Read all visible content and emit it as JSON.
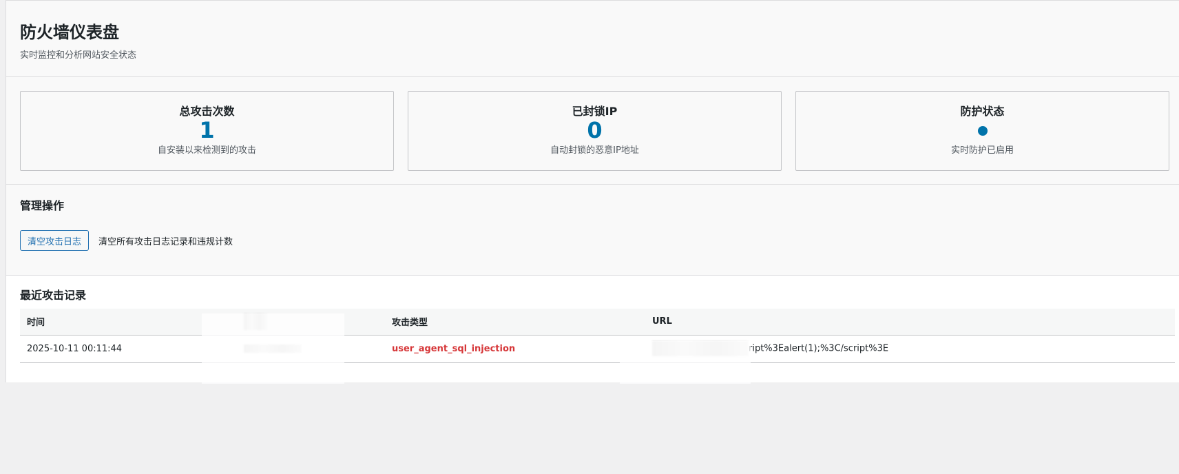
{
  "header": {
    "title": "防火墙仪表盘",
    "subtitle": "实时监控和分析网站安全状态"
  },
  "stats": [
    {
      "title": "总攻击次数",
      "value": "1",
      "desc": "自安装以来检测到的攻击"
    },
    {
      "title": "已封锁IP",
      "value": "0",
      "desc": "自动封锁的恶意IP地址"
    },
    {
      "title": "防护状态",
      "value": "",
      "desc": "实时防护已启用"
    }
  ],
  "admin": {
    "title": "管理操作",
    "clear_button": "清空攻击日志",
    "clear_desc": "清空所有攻击日志记录和违规计数"
  },
  "recent": {
    "title": "最近攻击记录",
    "columns": [
      "时间",
      "",
      "攻击类型",
      "URL"
    ],
    "rows": [
      {
        "time": "2025-10-11 00:11:44",
        "ip": "",
        "type": "user_agent_sql_injection",
        "url_visible": "ript%3Ealert(1);%3C/script%3E"
      }
    ]
  },
  "colors": {
    "accent": "#0073aa",
    "danger": "#d63638",
    "button": "#2271b1"
  }
}
